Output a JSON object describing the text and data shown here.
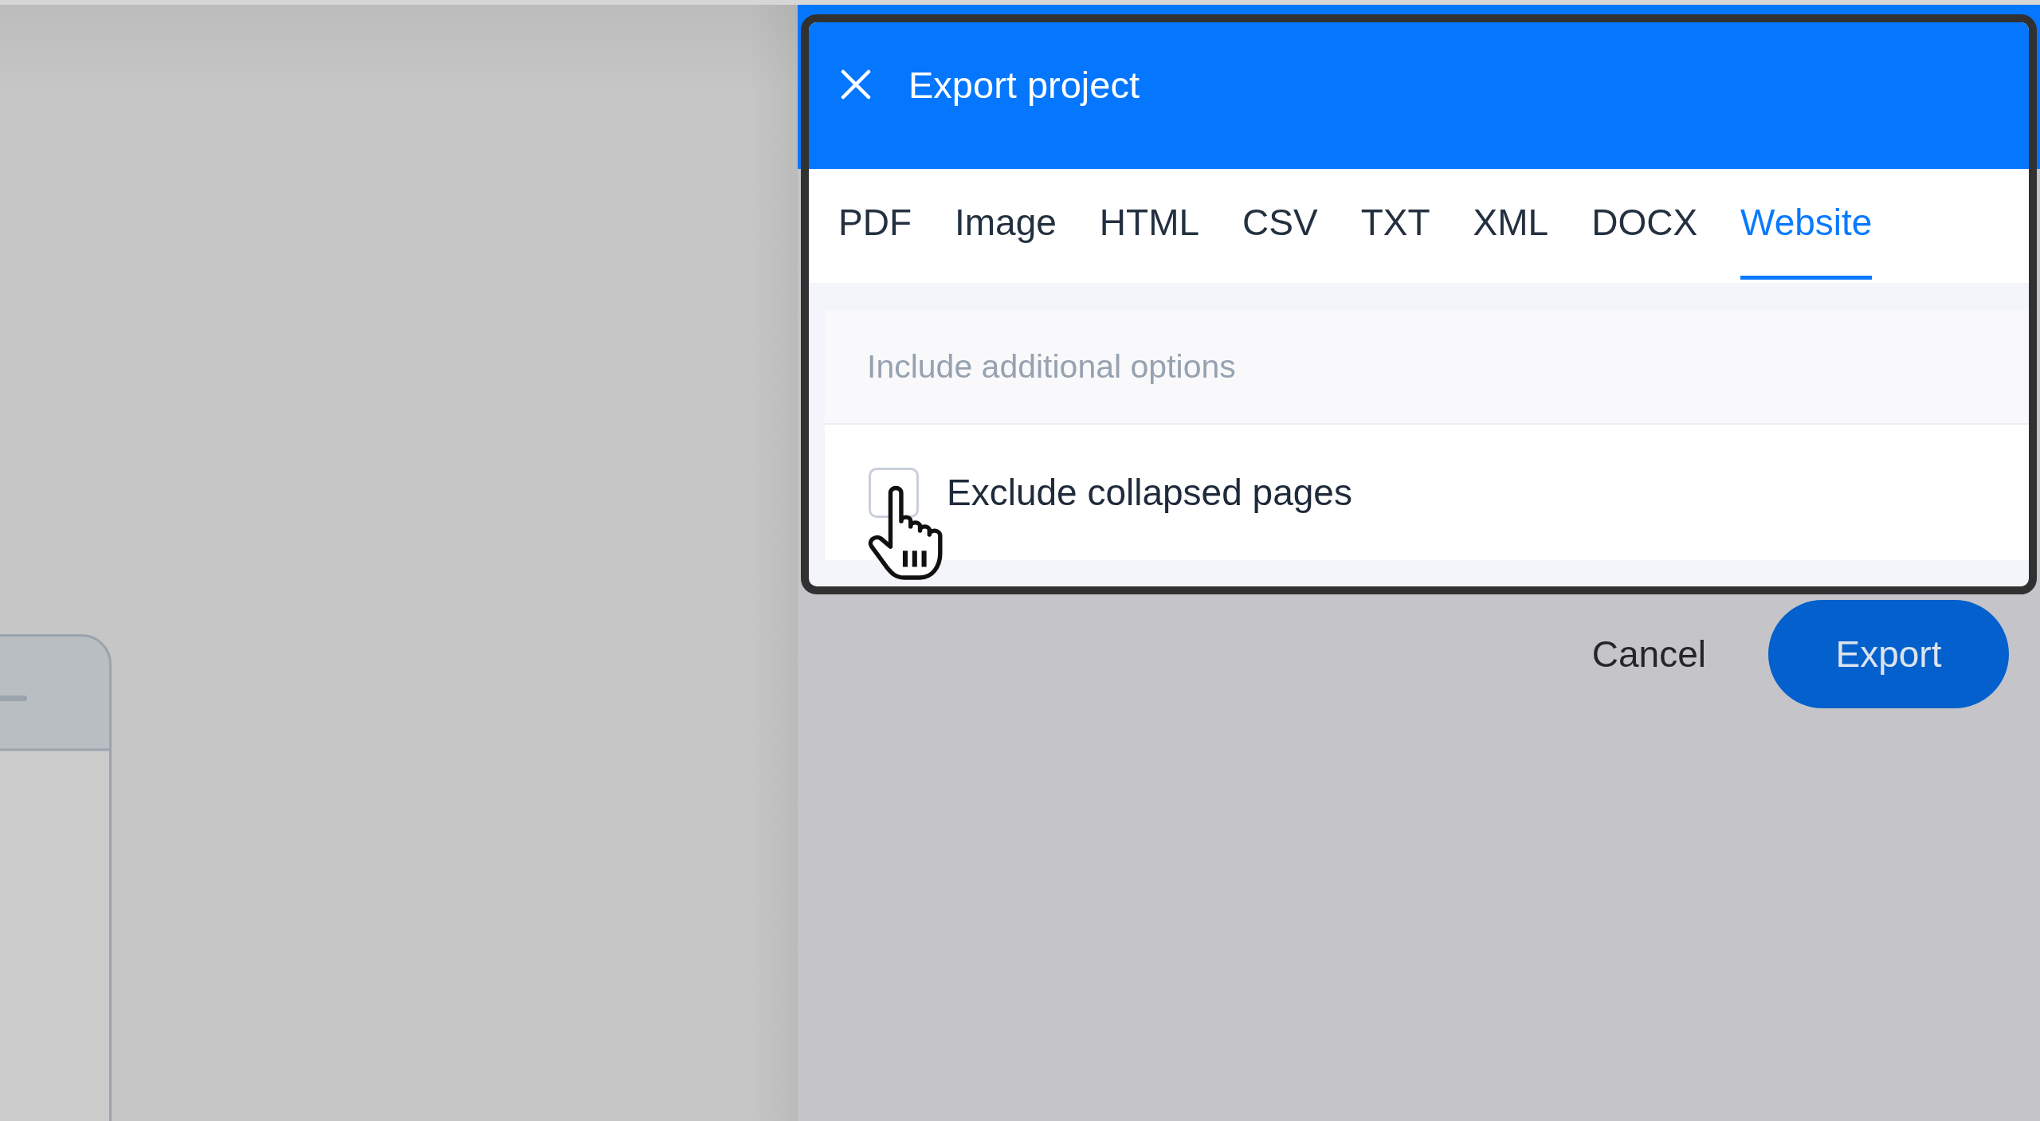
{
  "dialog": {
    "title": "Export project",
    "tabs": [
      {
        "label": "PDF",
        "selected": false
      },
      {
        "label": "Image",
        "selected": false
      },
      {
        "label": "HTML",
        "selected": false
      },
      {
        "label": "CSV",
        "selected": false
      },
      {
        "label": "TXT",
        "selected": false
      },
      {
        "label": "XML",
        "selected": false
      },
      {
        "label": "DOCX",
        "selected": false
      },
      {
        "label": "Website",
        "selected": true
      }
    ],
    "options_panel": {
      "heading": "Include additional options",
      "options": [
        {
          "label": "Exclude collapsed pages",
          "checked": false
        }
      ]
    }
  },
  "actions": [
    {
      "label": "Cancel",
      "kind": "secondary"
    },
    {
      "label": "Export",
      "kind": "primary"
    }
  ]
}
